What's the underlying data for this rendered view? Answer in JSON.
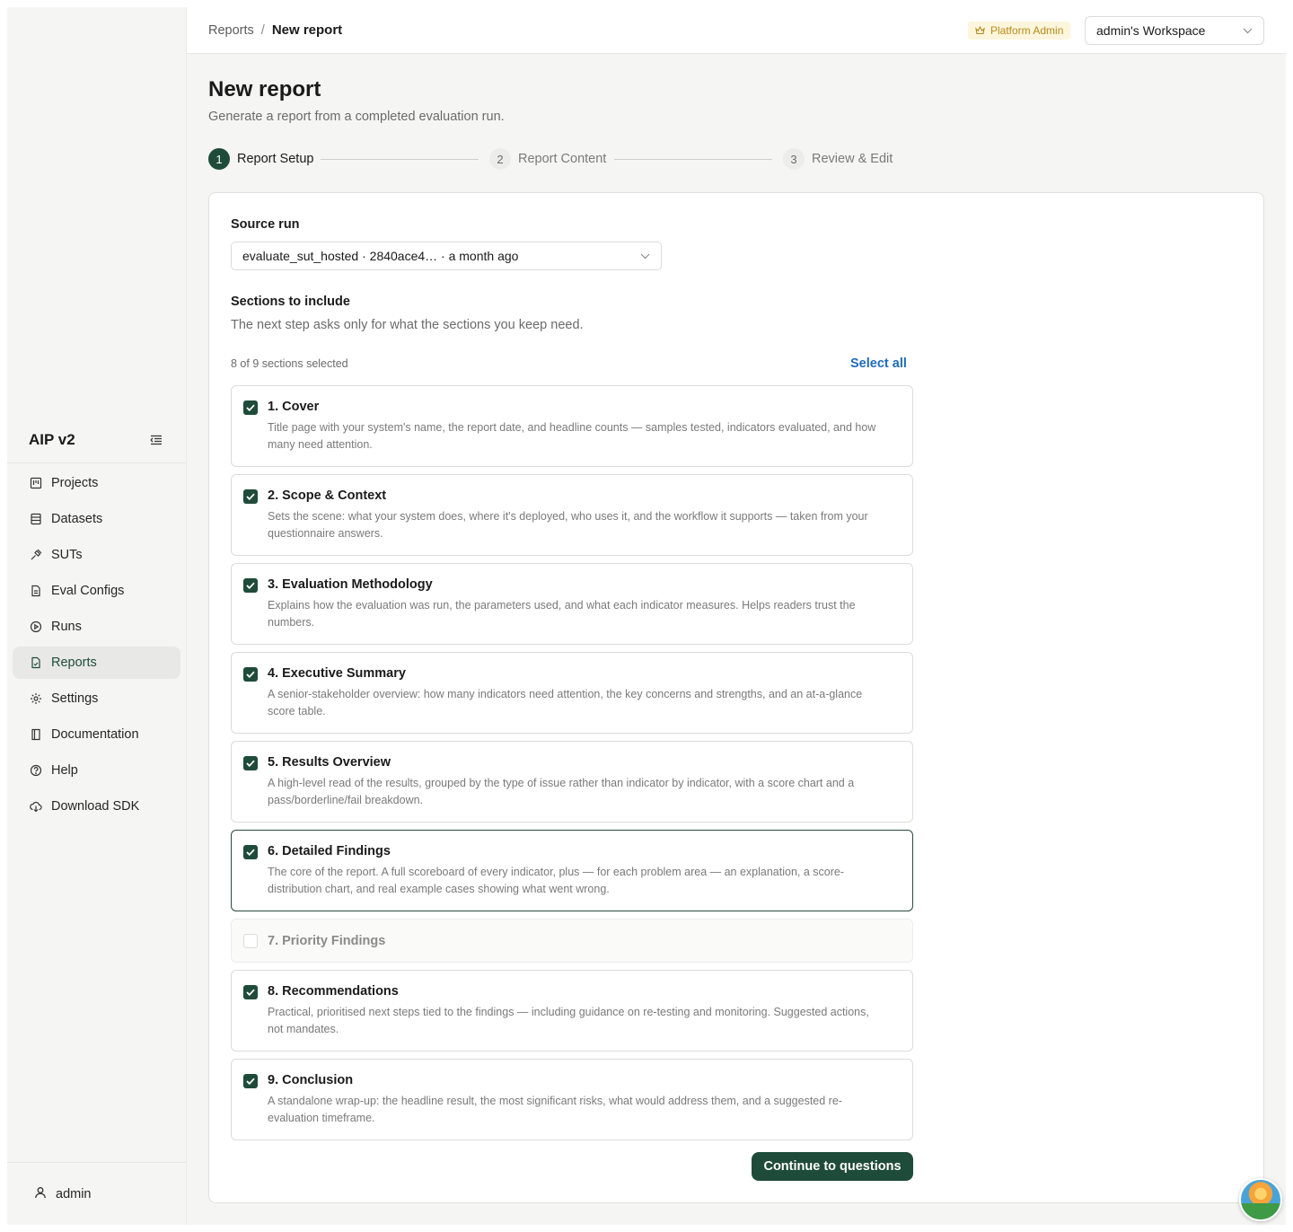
{
  "sidebar": {
    "brand": "AIP v2",
    "items": [
      {
        "label": "Projects",
        "icon": "projects-icon",
        "active": false
      },
      {
        "label": "Datasets",
        "icon": "datasets-icon",
        "active": false
      },
      {
        "label": "SUTs",
        "icon": "suts-icon",
        "active": false
      },
      {
        "label": "Eval Configs",
        "icon": "eval-configs-icon",
        "active": false
      },
      {
        "label": "Runs",
        "icon": "runs-icon",
        "active": false
      },
      {
        "label": "Reports",
        "icon": "reports-icon",
        "active": true
      },
      {
        "label": "Settings",
        "icon": "settings-icon",
        "active": false
      },
      {
        "label": "Documentation",
        "icon": "documentation-icon",
        "active": false
      },
      {
        "label": "Help",
        "icon": "help-icon",
        "active": false
      },
      {
        "label": "Download SDK",
        "icon": "download-sdk-icon",
        "active": false
      }
    ],
    "user": "admin"
  },
  "topbar": {
    "breadcrumb_parent": "Reports",
    "breadcrumb_sep": "/",
    "breadcrumb_current": "New report",
    "role_badge": "Platform Admin",
    "workspace": "admin's Workspace"
  },
  "page": {
    "title": "New report",
    "subtitle": "Generate a report from a completed evaluation run."
  },
  "stepper": [
    {
      "num": "1",
      "label": "Report Setup",
      "state": "active"
    },
    {
      "num": "2",
      "label": "Report Content",
      "state": "idle"
    },
    {
      "num": "3",
      "label": "Review & Edit",
      "state": "idle"
    }
  ],
  "form": {
    "source_run_label": "Source run",
    "source_run_value": "evaluate_sut_hosted · 2840ace4… · a month ago",
    "sections_label": "Sections to include",
    "sections_help": "The next step asks only for what the sections you keep need.",
    "selected_count": "8 of 9 sections selected",
    "select_all": "Select all",
    "continue_button": "Continue to questions"
  },
  "sections": [
    {
      "title": "1. Cover",
      "desc": "Title page with your system's name, the report date, and headline counts — samples tested, indicators evaluated, and how many need attention.",
      "checked": true
    },
    {
      "title": "2. Scope & Context",
      "desc": "Sets the scene: what your system does, where it's deployed, who uses it, and the workflow it supports — taken from your questionnaire answers.",
      "checked": true
    },
    {
      "title": "3. Evaluation Methodology",
      "desc": "Explains how the evaluation was run, the parameters used, and what each indicator measures. Helps readers trust the numbers.",
      "checked": true
    },
    {
      "title": "4. Executive Summary",
      "desc": "A senior-stakeholder overview: how many indicators need attention, the key concerns and strengths, and an at-a-glance score table.",
      "checked": true
    },
    {
      "title": "5. Results Overview",
      "desc": "A high-level read of the results, grouped by the type of issue rather than indicator by indicator, with a score chart and a pass/borderline/fail breakdown.",
      "checked": true
    },
    {
      "title": "6. Detailed Findings",
      "desc": "The core of the report. A full scoreboard of every indicator, plus — for each problem area — an explanation, a score-distribution chart, and real example cases showing what went wrong.",
      "checked": true,
      "focused": true
    },
    {
      "title": "7. Priority Findings",
      "desc": "",
      "checked": false
    },
    {
      "title": "8. Recommendations",
      "desc": "Practical, prioritised next steps tied to the findings — including guidance on re-testing and monitoring. Suggested actions, not mandates.",
      "checked": true
    },
    {
      "title": "9. Conclusion",
      "desc": "A standalone wrap-up: the headline result, the most significant risks, what would address them, and a suggested re-evaluation timeframe.",
      "checked": true
    }
  ],
  "colors": {
    "accent": "#1f4b3a",
    "link": "#1f6bb8",
    "badge_bg": "#fdf6dc",
    "badge_text": "#b7891c"
  }
}
